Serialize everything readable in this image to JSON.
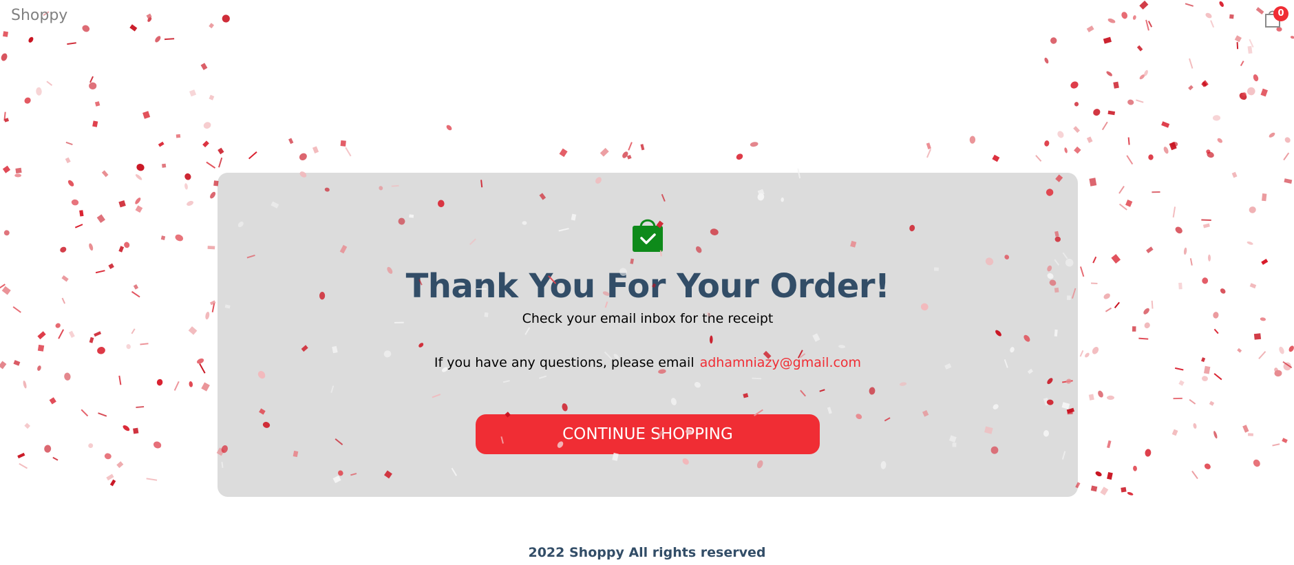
{
  "navbar": {
    "logo": "Shoppy",
    "cart_count": "0"
  },
  "success": {
    "title": "Thank You For Your Order!",
    "subtitle": "Check your email inbox for the receipt",
    "questions_text": "If you have any questions, please email",
    "email": "adhamniazy@gmail.com",
    "button_label": "CONTINUE SHOPPING"
  },
  "footer": {
    "text": "2022 Shoppy All rights reserved"
  },
  "colors": {
    "accent": "#f02d34",
    "heading": "#324d67",
    "card": "#dcdcdc",
    "bag": "#0e8a1a"
  },
  "icons": {
    "cart": "shopping-bag-icon",
    "success": "shopping-bag-check-icon"
  }
}
